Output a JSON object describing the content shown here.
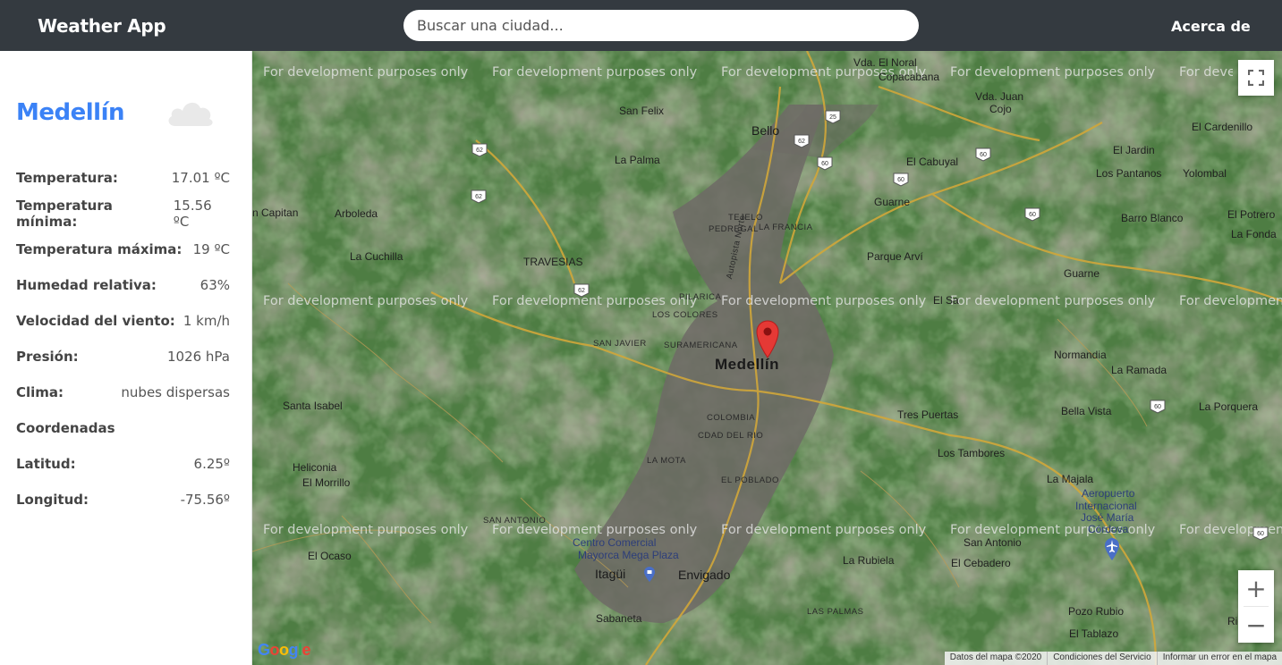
{
  "navbar": {
    "brand": "Weather App",
    "search_placeholder": "Buscar una ciudad...",
    "about": "Acerca de"
  },
  "weather": {
    "city": "Medellín",
    "icon": "cloud-icon",
    "rows": [
      {
        "label": "Temperatura:",
        "value": "17.01 ºC"
      },
      {
        "label": "Temperatura mínima:",
        "value": "15.56 ºC"
      },
      {
        "label": "Temperatura máxima:",
        "value": "19 ºC"
      },
      {
        "label": "Humedad relativa:",
        "value": "63%"
      },
      {
        "label": "Velocidad del viento:",
        "value": "1 km/h"
      },
      {
        "label": "Presión:",
        "value": "1026 hPa"
      },
      {
        "label": "Clima:",
        "value": "nubes dispersas"
      },
      {
        "label": "Coordenadas",
        "value": ""
      },
      {
        "label": "Latitud:",
        "value": "6.25º"
      },
      {
        "label": "Longitud:",
        "value": "-75.56º"
      }
    ]
  },
  "map": {
    "watermark": "For development purposes only",
    "places": {
      "vda_el_noral": "Vda. El Noral",
      "copacabana": "Copacabana",
      "vda_juan_cojo_1": "Vda. Juan",
      "vda_juan_cojo_2": "Cojo",
      "san_felix": "San Felix",
      "bello": "Bello",
      "el_cardenillo": "El Cardenillo",
      "el_jardin": "El Jardin",
      "la_palma": "La Palma",
      "el_cabuyal": "El Cabuyal",
      "los_pantanos": "Los Pantanos",
      "yolombal": "Yolombal",
      "guarne_top": "Guarne",
      "san_capitan": "n Capitan",
      "arboleda": "Arboleda",
      "tejelo": "TEJELO",
      "pedregal": "PEDREGAL",
      "la_francia": "LA FRANCIA",
      "barro_blanco": "Barro Blanco",
      "el_potrero": "El Potrero",
      "la_fonda": "La Fonda",
      "la_cuchilla": "La Cuchilla",
      "travesias": "TRAVESIAS",
      "parque_arvi": "Parque Arví",
      "guarne": "Guarne",
      "pilarica": "PILARICA",
      "el_sante": "El Sa",
      "los_colores": "LOS COLORES",
      "san_javier": "SAN JAVIER",
      "suramericana": "SURAMERICANA",
      "medellin": "Medellín",
      "normandia": "Normandia",
      "la_ramada": "La Ramada",
      "santa_isabel": "Santa Isabel",
      "tres_puertas": "Tres Puertas",
      "bella_vista": "Bella Vista",
      "la_porquera": "La Porquera",
      "colombia": "COLOMBIA",
      "cdad_del_rio": "CDAD DEL RIO",
      "los_tambores": "Los Tambores",
      "la_mota": "LA MOTA",
      "heliconia": "Heliconia",
      "el_morrillo": "El Morrillo",
      "la_majala": "La Majala",
      "el_poblado": "EL POBLADO",
      "aeropuerto_1": "Aeropuerto",
      "aeropuerto_2": "Internacional",
      "aeropuerto_3": "José María",
      "aeropuerto_4": "Córdova",
      "san_antonio_small": "SAN ANTONIO",
      "centro_comercial_1": "Centro Comercial",
      "centro_comercial_2": "Mayorca Mega Plaza",
      "san_antonio": "San Antonio",
      "el_ocaso": "El Ocaso",
      "itagui": "Itagüi",
      "envigado": "Envigado",
      "la_rubiela": "La Rubiela",
      "el_cebadero": "El Cebadero",
      "sabaneta": "Sabaneta",
      "las_palmas": "LAS PALMAS",
      "pozo_rubio": "Pozo Rubio",
      "rion": "Rion",
      "el_tablazo": "El Tablazo",
      "autopista_norte": "Autopista Norte"
    },
    "shields": [
      "25",
      "62",
      "62",
      "60",
      "60",
      "60",
      "62",
      "60",
      "62",
      "60",
      "60"
    ],
    "footer": {
      "data": "Datos del mapa ©2020",
      "terms": "Condiciones del Servicio",
      "report": "Informar un error en el mapa"
    },
    "google": "Google",
    "zoom_in": "+",
    "zoom_out": "−"
  }
}
